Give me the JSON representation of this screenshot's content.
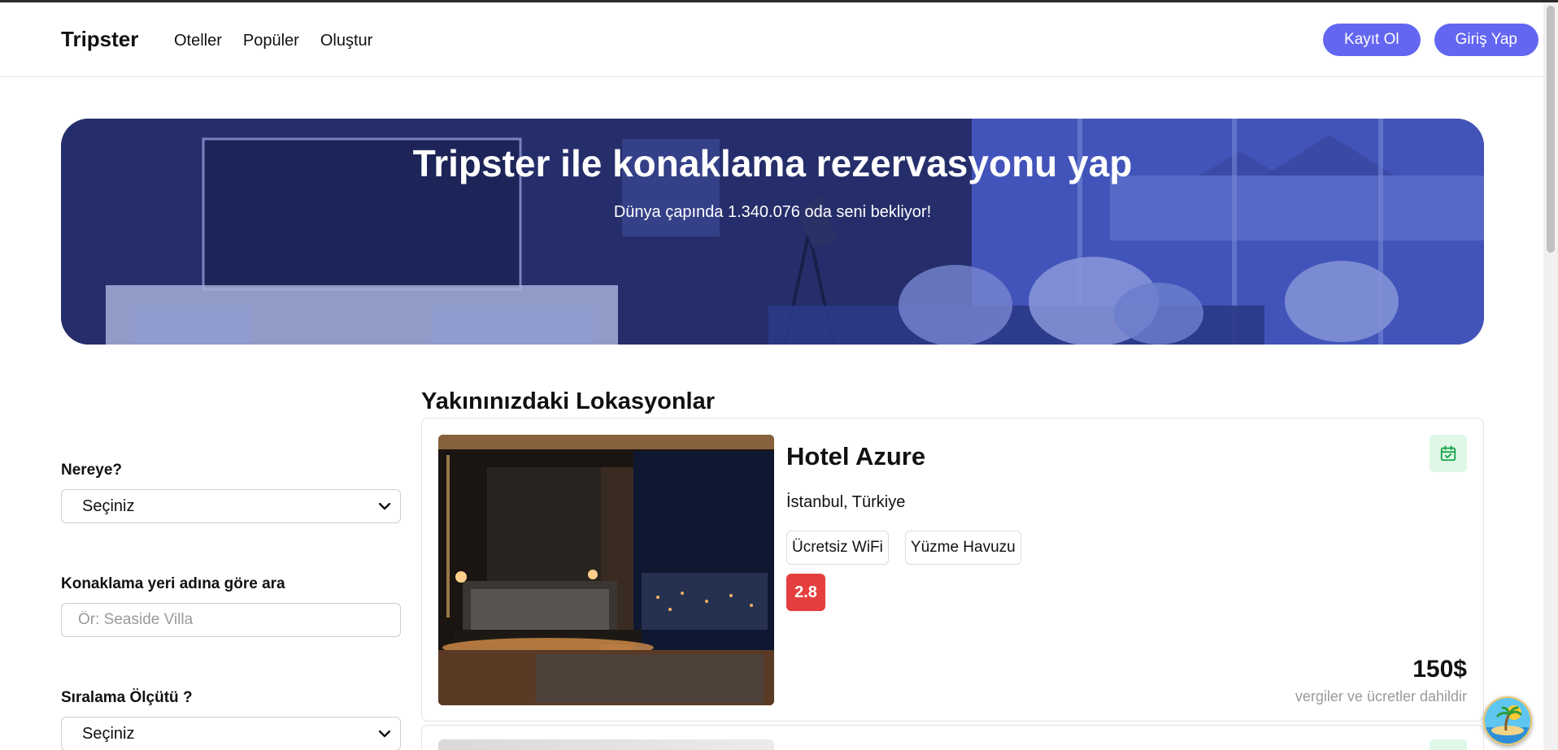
{
  "nav": {
    "brand": "Tripster",
    "links": [
      "Oteller",
      "Popüler",
      "Oluştur"
    ],
    "register_label": "Kayıt Ol",
    "login_label": "Giriş Yap"
  },
  "hero": {
    "title": "Tripster ile konaklama rezervasyonu yap",
    "subtitle": "Dünya çapında 1.340.076 oda seni bekliyor!"
  },
  "filters": {
    "destination_label": "Nereye?",
    "destination_value": "Seçiniz",
    "name_search_label": "Konaklama yeri adına göre ara",
    "name_search_placeholder": "Ör: Seaside Villa",
    "sort_label": "Sıralama Ölçütü ?",
    "sort_value": "Seçiniz"
  },
  "listings": {
    "title": "Yakınınızdaki Lokasyonlar",
    "items": [
      {
        "name": "Hotel Azure",
        "location": "İstanbul, Türkiye",
        "amenities": [
          "Ücretsiz WiFi",
          "Yüzme Havuzu"
        ],
        "rating": "2.8",
        "price": "150$",
        "price_note": "vergiler ve ücretler dahildir"
      }
    ]
  },
  "colors": {
    "accent": "#6366f1",
    "rating_bad": "#e53e3e",
    "calendar_bg": "#def7e6",
    "calendar_icon": "#16a34a"
  },
  "icons": {
    "calendar": "calendar-check-icon",
    "chevron": "chevron-down-icon",
    "chat": "island-chat-icon"
  }
}
